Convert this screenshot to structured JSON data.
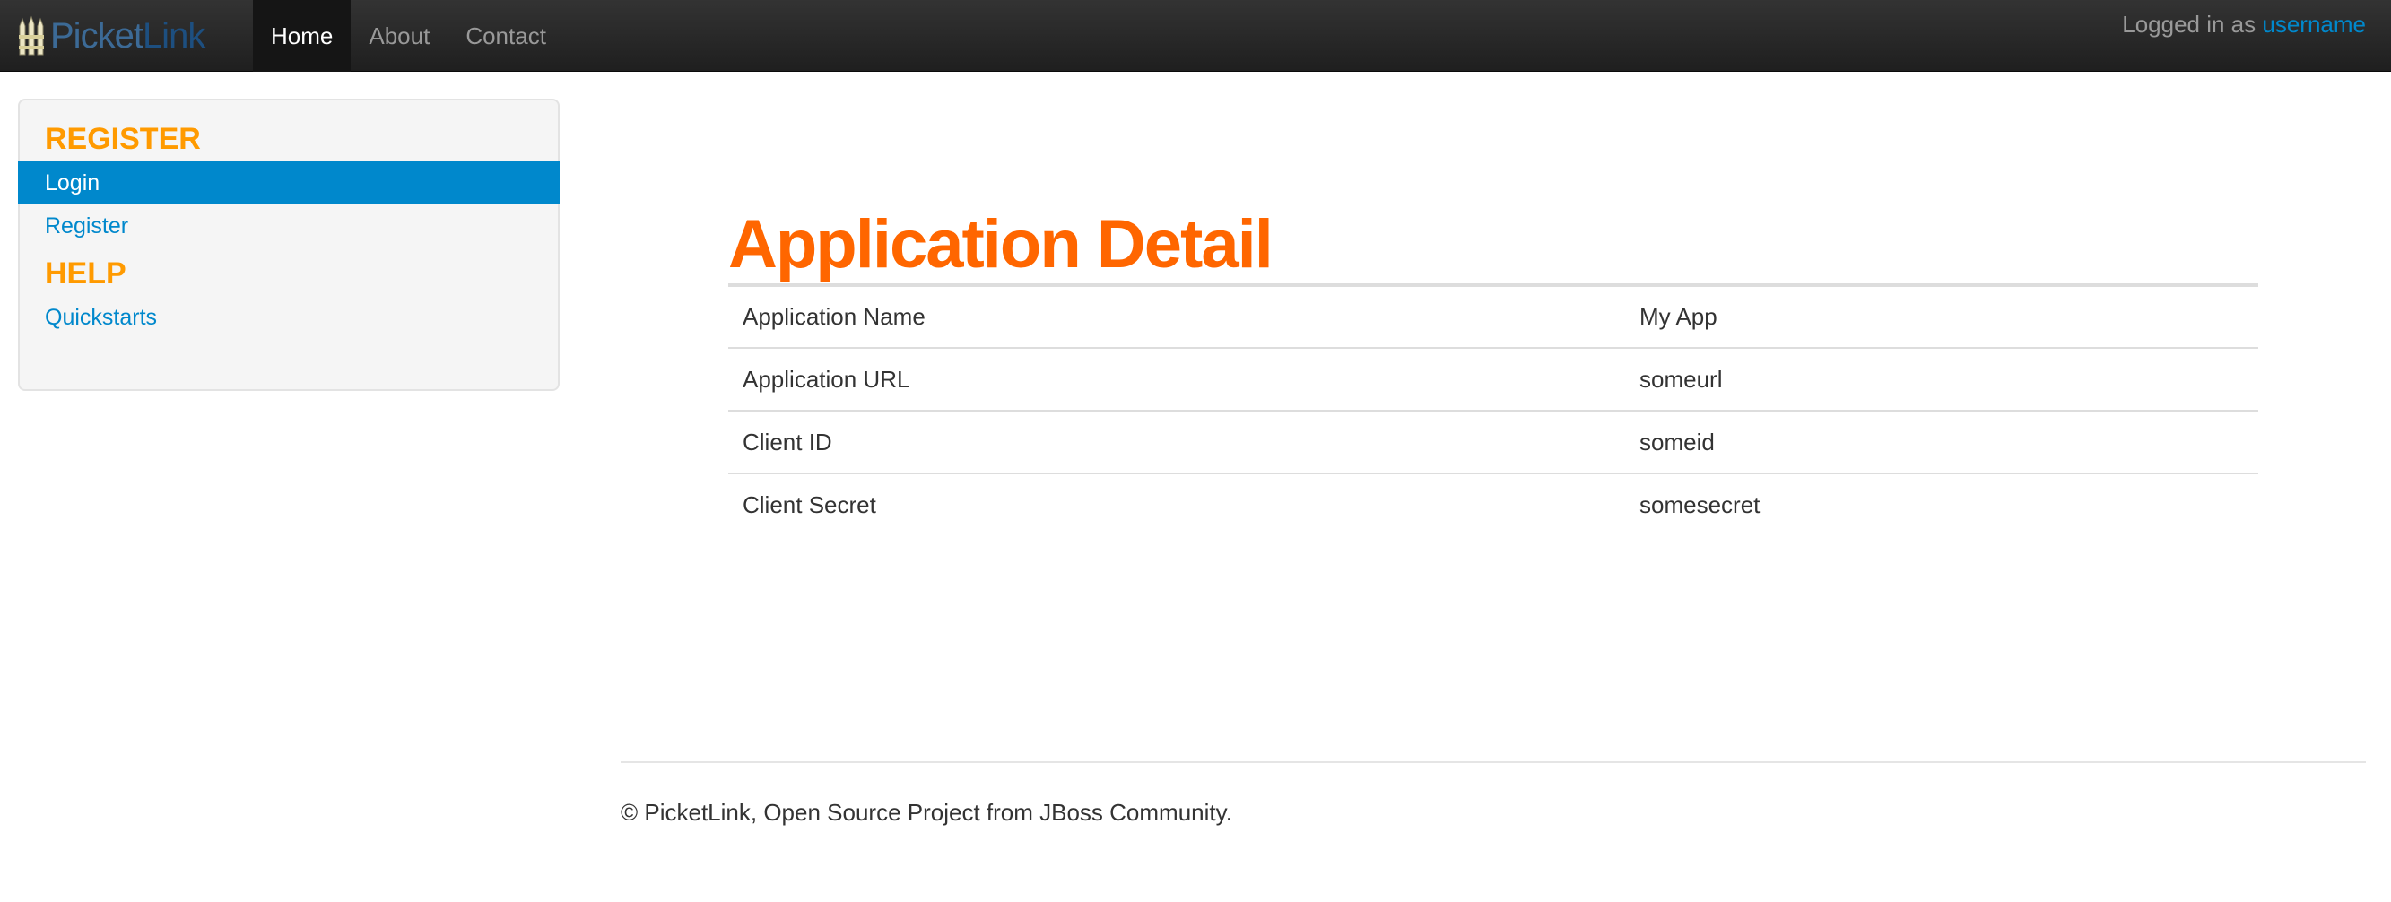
{
  "navbar": {
    "brand": {
      "part1": "Picket",
      "part2": "Link",
      "logo_icon": "picketlink-fence-icon"
    },
    "items": [
      {
        "label": "Home",
        "active": true
      },
      {
        "label": "About",
        "active": false
      },
      {
        "label": "Contact",
        "active": false
      }
    ],
    "status_prefix": "Logged in as",
    "status_user": "username"
  },
  "sidebar": {
    "register_header": "REGISTER",
    "register_links": [
      {
        "label": "Login",
        "active": true
      },
      {
        "label": "Register",
        "active": false
      }
    ],
    "help_header": "HELP",
    "help_links": [
      {
        "label": "Quickstarts",
        "active": false
      }
    ]
  },
  "main": {
    "title": "Application Detail",
    "rows": [
      {
        "label": "Application Name",
        "value": "My App"
      },
      {
        "label": "Application URL",
        "value": "someurl"
      },
      {
        "label": "Client ID",
        "value": "someid"
      },
      {
        "label": "Client Secret",
        "value": "somesecret"
      }
    ]
  },
  "footer": {
    "text": "© PicketLink, Open Source Project from JBoss Community."
  },
  "colors": {
    "accent_orange": "#ff6600",
    "header_orange": "#ff9a00",
    "link_blue": "#0088cc",
    "navbar_dark": "#222222"
  }
}
